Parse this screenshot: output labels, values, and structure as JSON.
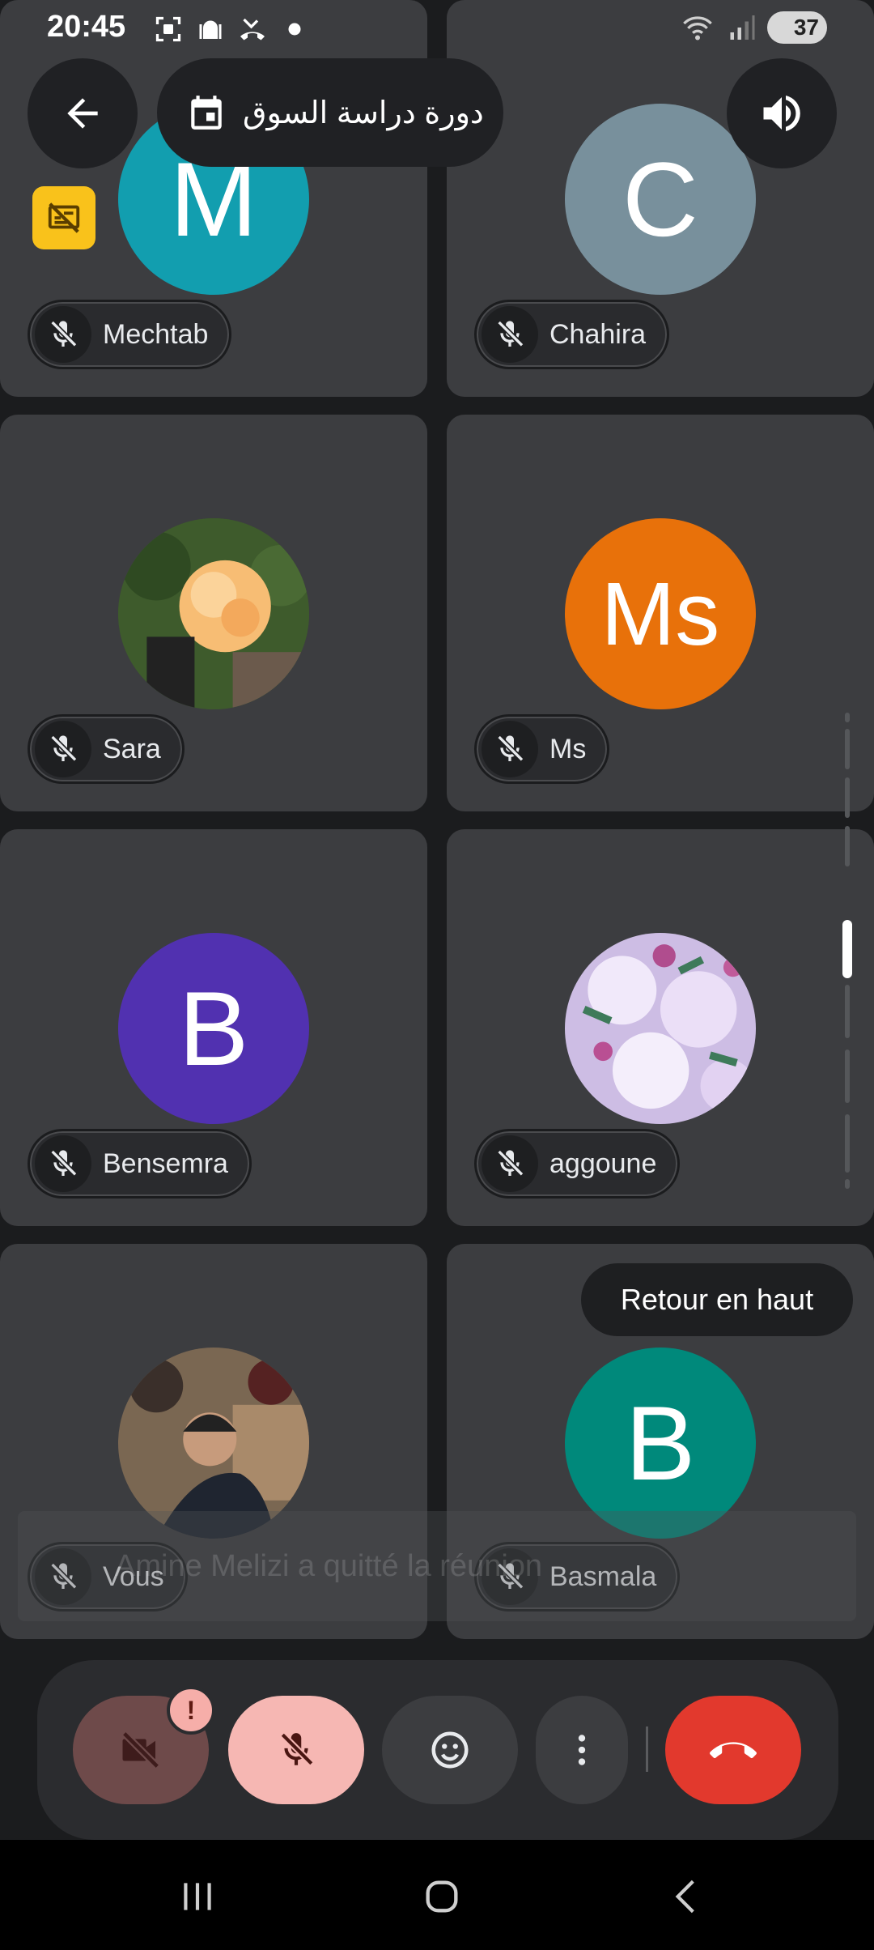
{
  "status": {
    "time": "20:45",
    "battery": "37"
  },
  "meeting": {
    "title": "دورة دراسة السوق"
  },
  "participants": [
    {
      "name": "Mechtab",
      "initial": "M",
      "color": "#129eaf"
    },
    {
      "name": "Chahira",
      "initial": "C",
      "color": "#78909c"
    },
    {
      "name": "Sara",
      "initial": "",
      "color": "#3a5a2a"
    },
    {
      "name": "Ms",
      "initial": "Ms",
      "color": "#e8710a"
    },
    {
      "name": "Bensemra",
      "initial": "B",
      "color": "#5131b0"
    },
    {
      "name": "aggoune",
      "initial": "",
      "color": "#d7c8ea"
    },
    {
      "name": "Vous",
      "initial": "",
      "color": "#6a5a4a"
    },
    {
      "name": "Basmala",
      "initial": "B",
      "color": "#00897b"
    }
  ],
  "back_to_top": "Retour en haut",
  "toast": "Amine Melizi a quitté la réunion",
  "controls": {
    "camera_warning": "!"
  },
  "colors": {
    "end_call": "#e2392d",
    "mic_off_bg": "#f6b7b3",
    "camera_off_bg": "#6e4a4a",
    "no_screen_badge": "#f9c21b"
  }
}
